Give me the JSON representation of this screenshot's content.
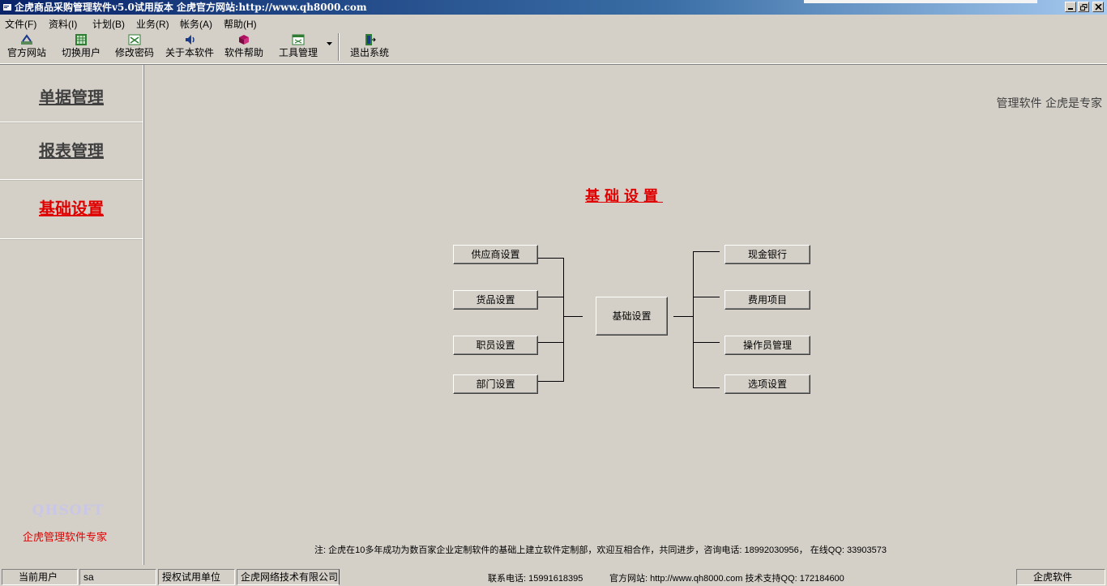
{
  "window": {
    "title": "企虎商品采购管理软件v5.0试用版本 企虎官方网站:http://www.qh8000.com"
  },
  "menu": [
    {
      "label": "文件(F)"
    },
    {
      "label": "资料(I)"
    },
    {
      "label": "计划(B)"
    },
    {
      "label": "业务(R)"
    },
    {
      "label": "帐务(A)"
    },
    {
      "label": "帮助(H)"
    }
  ],
  "toolbar": [
    {
      "label": "官方网站",
      "icon": "website-icon"
    },
    {
      "label": "切换用户",
      "icon": "switch-user-icon"
    },
    {
      "label": "修改密码",
      "icon": "password-icon"
    },
    {
      "label": "关于本软件",
      "icon": "about-icon"
    },
    {
      "label": "软件帮助",
      "icon": "help-book-icon"
    },
    {
      "label": "工具管理",
      "icon": "tools-icon"
    },
    {
      "label": "退出系统",
      "icon": "exit-icon"
    }
  ],
  "nav": [
    {
      "label": "单据管理",
      "active": false
    },
    {
      "label": "报表管理",
      "active": false
    },
    {
      "label": "基础设置",
      "active": true
    }
  ],
  "brand": {
    "logo_text": "QHSOFT",
    "slogan": "企虎管理软件专家"
  },
  "tagline": "管理软件 企虎是专家",
  "diagram": {
    "heading": "基础设置",
    "center": "基础设置",
    "left": [
      "供应商设置",
      "货品设置",
      "职员设置",
      "部门设置"
    ],
    "right": [
      "现金银行",
      "费用项目",
      "操作员管理",
      "选项设置"
    ]
  },
  "note": "注: 企虎在10多年成功为数百家企业定制软件的基础上建立软件定制部，欢迎互相合作，共同进步，咨询电话: 18992030956，  在线QQ: 33903573",
  "status": {
    "user_label": "当前用户",
    "user_value": "sa",
    "license_label": "授权试用单位",
    "license_value": "企虎网络技术有限公司",
    "phone": "联系电话: 15991618395",
    "site": "官方网站: http://www.qh8000.com 技术支持QQ: 172184600",
    "brand": "企虎软件"
  },
  "colors": {
    "accent_red": "#e00000",
    "face": "#d4d0c8",
    "title_bar": "#0a246a"
  }
}
